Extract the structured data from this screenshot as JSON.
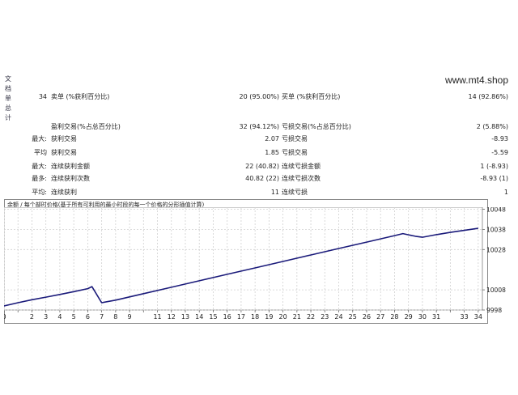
{
  "side_tab": [
    "文",
    "档",
    "单",
    "总",
    "计"
  ],
  "watermark": "www.mt4.shop",
  "stats": {
    "row1": {
      "count": "34",
      "sell_label": "卖单 (%获利百分比)",
      "sell_value": "20 (95.00%)",
      "buy_label": "买单 (%获利百分比)",
      "buy_value": "14 (92.86%)"
    },
    "row2": {
      "profit_label": "盈利交易(%占总百分比)",
      "profit_value": "32 (94.12%)",
      "loss_label": "亏损交易(%占总百分比)",
      "loss_value": "2 (5.88%)"
    },
    "row3": {
      "prefix": "最大:",
      "left_label": "获利交易",
      "left_value": "2.07",
      "right_label": "亏损交易",
      "right_value": "-8.93"
    },
    "row4": {
      "prefix": "平均",
      "left_label": "获利交易",
      "left_value": "1.85",
      "right_label": "亏损交易",
      "right_value": "-5.59"
    },
    "row5": {
      "prefix": "最大:",
      "left_label": "连续获利金额",
      "left_value": "22 (40.82)",
      "right_label": "连续亏损金额",
      "right_value": "1 (-8.93)"
    },
    "row6": {
      "prefix": "最多:",
      "left_label": "连续获利次数",
      "left_value": "40.82 (22)",
      "right_label": "连续亏损次数",
      "right_value": "-8.93 (1)"
    },
    "row7": {
      "prefix": "平均:",
      "left_label": "连续获利",
      "left_value": "11",
      "right_label": "连续亏损",
      "right_value": "1"
    }
  },
  "chart_data": {
    "type": "line",
    "title": "余额 / 每个部时价格(基于所有可利用的最小时段的每一个价格的分形插值计算)",
    "x_ticks": [
      0,
      1,
      2,
      3,
      4,
      5,
      6,
      7,
      8,
      9,
      10,
      11,
      12,
      13,
      14,
      15,
      16,
      17,
      18,
      19,
      20,
      21,
      22,
      23,
      24,
      25,
      26,
      27,
      28,
      29,
      30,
      31,
      32,
      33,
      34
    ],
    "x_tick_labels": [
      "0",
      "2",
      "3",
      "4",
      "5",
      "6",
      "7",
      "8",
      "9",
      "11",
      "12",
      "13",
      "14",
      "15",
      "16",
      "17",
      "18",
      "19",
      "20",
      "21",
      "22",
      "23",
      "24",
      "25",
      "26",
      "27",
      "28",
      "29",
      "30",
      "31",
      "33",
      "34"
    ],
    "y_ticks": [
      9998,
      10008,
      10028,
      10038,
      10048
    ],
    "y_tick_labels": [
      "9998",
      "10008",
      "10028",
      "10038",
      "10048"
    ],
    "xlim": [
      0,
      34.3
    ],
    "ylim": [
      9998,
      10049
    ],
    "grid": true,
    "line_color": "#1a1a7a",
    "series": [
      {
        "x": [
          0,
          1,
          2,
          3,
          4,
          5,
          6,
          6.3,
          7,
          8,
          10,
          12,
          14,
          16,
          18,
          20,
          22,
          24,
          26,
          28,
          28.6,
          29,
          29.5,
          30,
          31,
          32,
          33,
          34
        ],
        "y": [
          10000,
          10001.6,
          10003.1,
          10004.4,
          10005.7,
          10007.1,
          10008.6,
          10009.6,
          10001.6,
          10002.9,
          10006.1,
          10009.3,
          10012.5,
          10015.7,
          10018.9,
          10022.1,
          10025.3,
          10028.5,
          10031.7,
          10034.9,
          10035.9,
          10035.3,
          10034.6,
          10034.1,
          10035.4,
          10036.5,
          10037.5,
          10038.5
        ]
      }
    ]
  }
}
